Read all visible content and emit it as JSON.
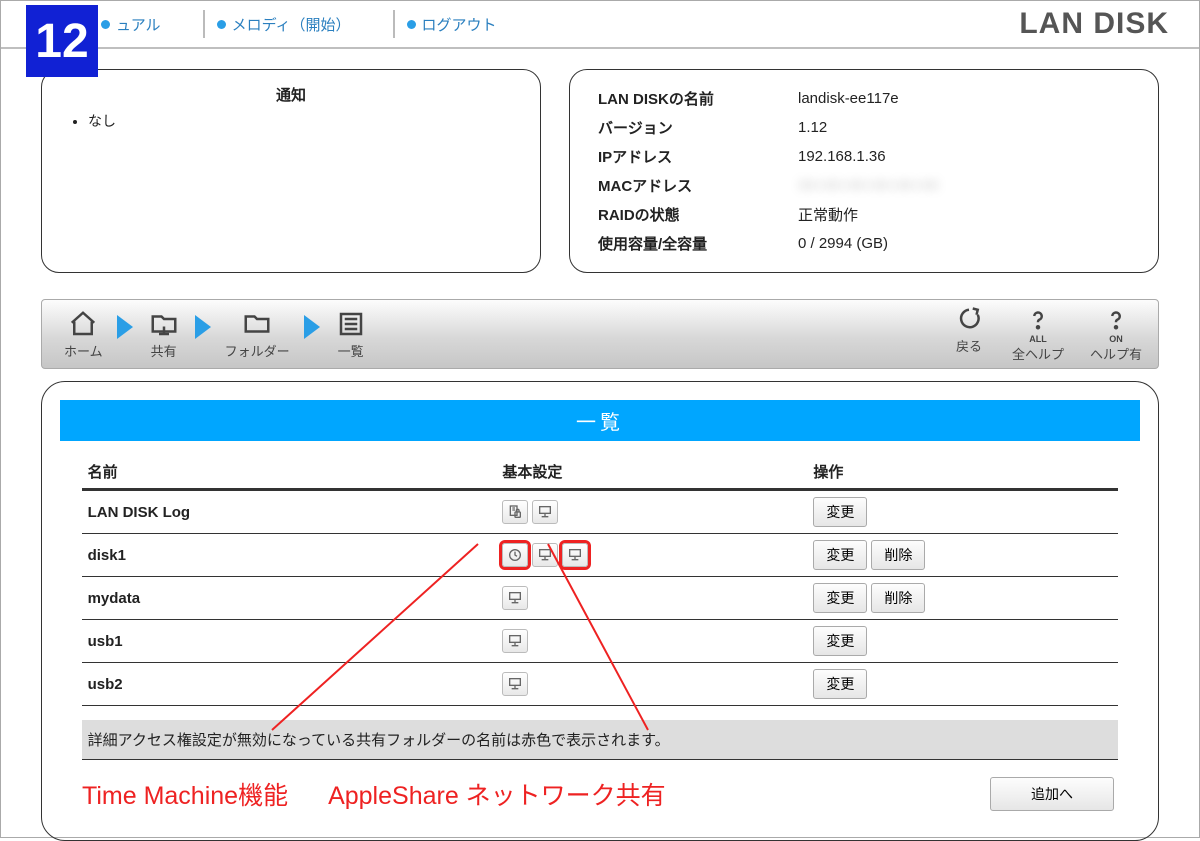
{
  "step_badge": "12",
  "topnav": {
    "manual_partial": "ュアル",
    "melody": "メロディ（開始）",
    "logout": "ログアウト",
    "logo": "LAN DISK"
  },
  "notice": {
    "title": "通知",
    "items": [
      "なし"
    ]
  },
  "sysinfo": [
    {
      "label": "LAN DISKの名前",
      "value": "landisk-ee117e"
    },
    {
      "label": "バージョン",
      "value": "1.12"
    },
    {
      "label": "IPアドレス",
      "value": "192.168.1.36"
    },
    {
      "label": "MACアドレス",
      "value": "XX:XX:XX:XX:XX:XX",
      "blurred": true
    },
    {
      "label": "RAIDの状態",
      "value": "正常動作"
    },
    {
      "label": "使用容量/全容量",
      "value": "0 / 2994 (GB)"
    }
  ],
  "breadcrumb": {
    "home": "ホーム",
    "share": "共有",
    "folder": "フォルダー",
    "list": "一覧"
  },
  "side_actions": {
    "back": "戻る",
    "help_all": "全ヘルプ",
    "help_all_sub": "ALL",
    "help_on": "ヘルプ有",
    "help_on_sub": "ON"
  },
  "list": {
    "title": "一覧",
    "columns": {
      "name": "名前",
      "basic": "基本設定",
      "ops": "操作"
    },
    "note": "詳細アクセス権設定が無効になっている共有フォルダーの名前は赤色で表示されます。",
    "rows": [
      {
        "name": "LAN DISK Log",
        "icons": [
          "lock-doc",
          "net-share"
        ],
        "ops": [
          "変更"
        ]
      },
      {
        "name": "disk1",
        "icons": [
          "time-machine",
          "net-share",
          "apple-share"
        ],
        "highlight": [
          0,
          2
        ],
        "ops": [
          "変更",
          "削除"
        ]
      },
      {
        "name": "mydata",
        "icons": [
          "net-share"
        ],
        "ops": [
          "変更",
          "削除"
        ]
      },
      {
        "name": "usb1",
        "icons": [
          "net-share"
        ],
        "ops": [
          "変更"
        ]
      },
      {
        "name": "usb2",
        "icons": [
          "net-share"
        ],
        "ops": [
          "変更"
        ]
      }
    ],
    "add_button": "追加へ"
  },
  "annotations": {
    "time_machine": "Time Machine機能",
    "apple_share": "AppleShare ネットワーク共有"
  }
}
